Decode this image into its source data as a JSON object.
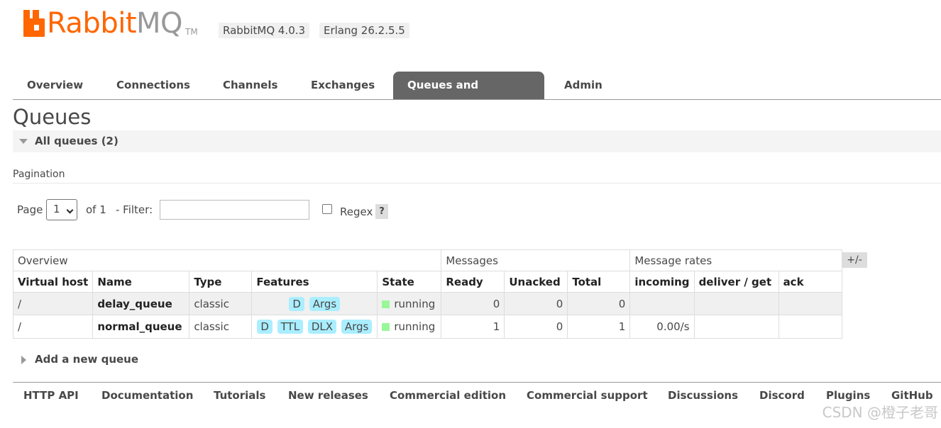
{
  "header": {
    "logo_rabbit": "Rabbit",
    "logo_mq": "MQ",
    "logo_tm": "TM",
    "rabbitmq_version": "RabbitMQ 4.0.3",
    "erlang_version": "Erlang 26.2.5.5"
  },
  "tabs": [
    {
      "label": "Overview"
    },
    {
      "label": "Connections"
    },
    {
      "label": "Channels"
    },
    {
      "label": "Exchanges"
    },
    {
      "label": "Queues and Streams",
      "active": true
    },
    {
      "label": "Admin"
    }
  ],
  "page": {
    "title": "Queues",
    "section": "All queues (2)",
    "pagination_label": "Pagination"
  },
  "pager": {
    "page_label": "Page",
    "page_value": "1",
    "of_label": "of 1",
    "filter_label": "- Filter:",
    "filter_value": "",
    "regex_label": "Regex",
    "regex_checked": false,
    "help": "?"
  },
  "table": {
    "groups": [
      "Overview",
      "Messages",
      "Message rates"
    ],
    "columns": [
      "Virtual host",
      "Name",
      "Type",
      "Features",
      "State",
      "Ready",
      "Unacked",
      "Total",
      "incoming",
      "deliver / get",
      "ack"
    ],
    "toggle_columns": "+/-",
    "rows": [
      {
        "vhost": "/",
        "name": "delay_queue",
        "type": "classic",
        "features": [
          "D",
          "Args"
        ],
        "state": "running",
        "ready": "0",
        "unacked": "0",
        "total": "0",
        "incoming": "",
        "deliver_get": "",
        "ack": ""
      },
      {
        "vhost": "/",
        "name": "normal_queue",
        "type": "classic",
        "features": [
          "D",
          "TTL",
          "DLX",
          "Args"
        ],
        "state": "running",
        "ready": "1",
        "unacked": "0",
        "total": "1",
        "incoming": "0.00/s",
        "deliver_get": "",
        "ack": ""
      }
    ]
  },
  "add_queue": "Add a new queue",
  "footer": [
    "HTTP API",
    "Documentation",
    "Tutorials",
    "New releases",
    "Commercial edition",
    "Commercial support",
    "Discussions",
    "Discord",
    "Plugins",
    "GitHub"
  ],
  "watermark": "CSDN @橙子老哥",
  "colors": {
    "brand_orange": "#ff6600",
    "tab_active_bg": "#666666",
    "feature_badge": "#aaeeff",
    "state_running": "#98f898"
  }
}
